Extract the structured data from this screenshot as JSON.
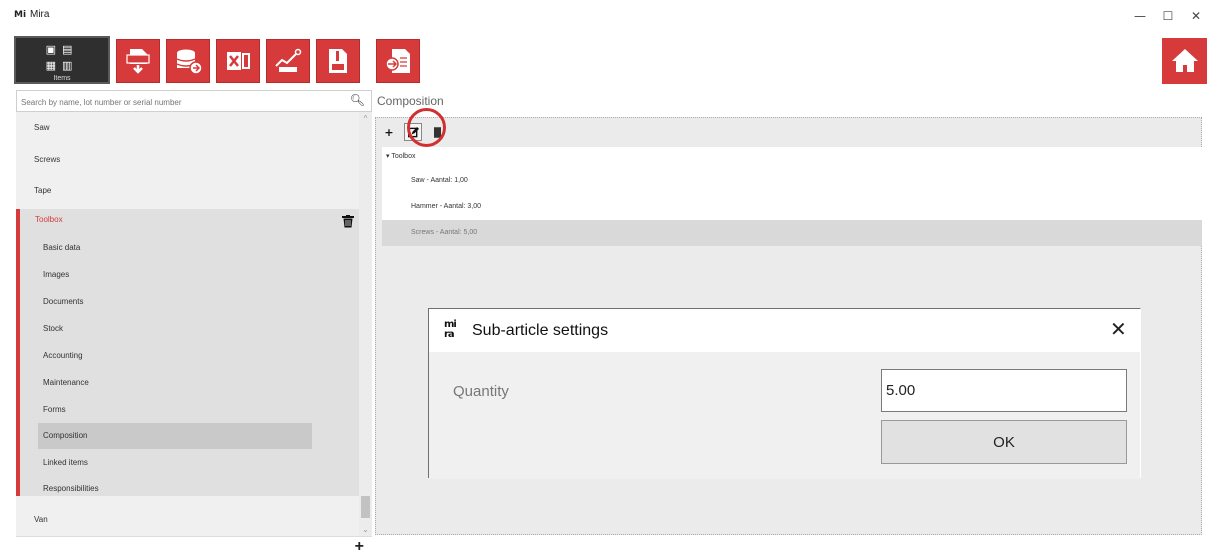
{
  "window": {
    "title": "Mira",
    "logo_text": "Mi",
    "minimize": "—",
    "maximize": "☐",
    "close": "✕"
  },
  "toolbar": {
    "items_label": "Items",
    "buttons": [
      {
        "icon": "csv-export-icon"
      },
      {
        "icon": "database-import-icon"
      },
      {
        "icon": "excel-icon"
      },
      {
        "icon": "chart-icon"
      },
      {
        "icon": "zip-icon"
      },
      {
        "icon": "document-import-icon"
      }
    ],
    "home_icon": "home-icon"
  },
  "colors": {
    "accent": "#d63a3a",
    "panel": "#e8e8e8",
    "selected": "#c9c9c9"
  },
  "search": {
    "placeholder": "Search by name, lot number or serial number"
  },
  "tree": {
    "items": [
      "Saw",
      "Screws",
      "Tape"
    ],
    "expanded": {
      "label": "Toolbox",
      "children": [
        "Basic data",
        "Images",
        "Documents",
        "Stock",
        "Accounting",
        "Maintenance",
        "Forms",
        "Composition",
        "Linked items",
        "Responsibilities"
      ],
      "selected_child": "Composition"
    },
    "after": [
      "Van"
    ]
  },
  "composition": {
    "title": "Composition",
    "root": "Toolbox",
    "items": [
      "Saw - Aantal: 1,00",
      "Hammer - Aantal: 3,00",
      "Screws - Aantal: 5,00"
    ],
    "selected_index": 2
  },
  "dialog": {
    "title": "Sub-article settings",
    "logo_line1": "mi",
    "logo_line2": "ra",
    "close": "✕",
    "quantity_label": "Quantity",
    "quantity_value": "5.00",
    "ok_label": "OK"
  }
}
